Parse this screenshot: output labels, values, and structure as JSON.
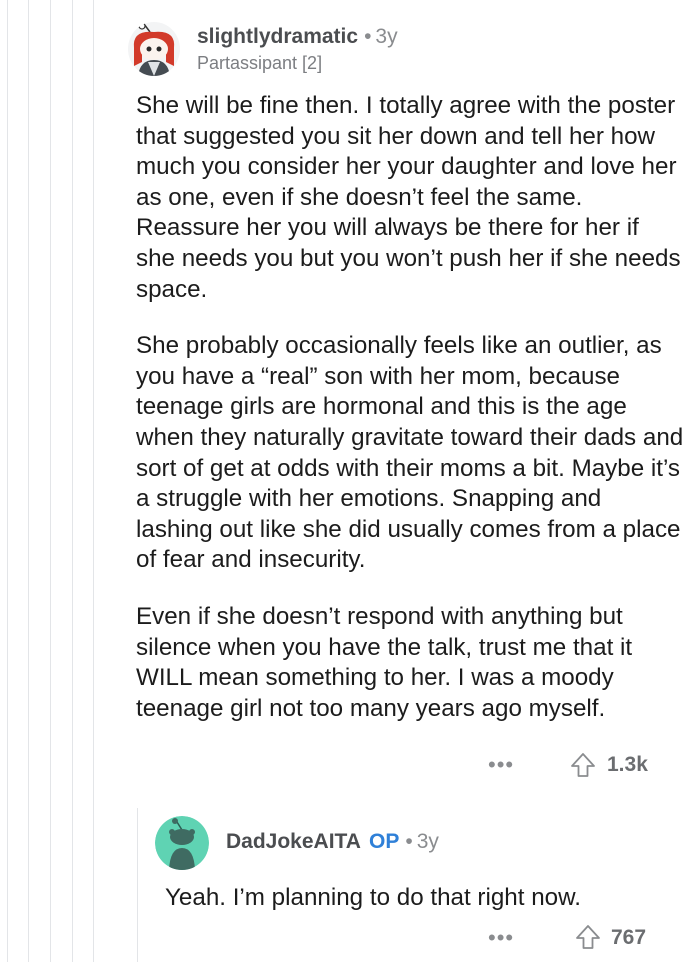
{
  "comment1": {
    "username": "slightlydramatic",
    "separator": "•",
    "age": "3y",
    "flair": "Partassipant [2]",
    "paragraphs": [
      "She will be fine then.  I totally agree with the poster that suggested you sit her down and tell her how much you consider her your daughter and love her as one, even if she doesn’t feel the same.  Reassure her you will always be there for her if she needs you but you won’t push her if she needs space.",
      "She probably occasionally feels like an outlier, as you have a “real” son with her mom, because teenage girls are hormonal and this is the age when they naturally gravitate toward their dads and sort of get at odds with their moms a bit.  Maybe it’s a struggle with her emotions.  Snapping and lashing out like she did usually comes from a place of fear and insecurity.",
      "Even if she doesn’t respond with anything but silence when you have the talk, trust me that it WILL mean something to her.  I was a moody teenage girl not too many years ago myself."
    ],
    "more_label": "•••",
    "score": "1.3k"
  },
  "comment2": {
    "username": "DadJokeAITA",
    "op_label": "OP",
    "separator": "•",
    "age": "3y",
    "paragraphs": [
      "Yeah. I’m planning to do that right now."
    ],
    "more_label": "•••",
    "score": "767"
  },
  "colors": {
    "op_blue": "#2f80d8",
    "avatar2_bg": "#5fd3b3",
    "avatar1_hair": "#d23a2a",
    "thread_line": "#e3e5e8"
  }
}
